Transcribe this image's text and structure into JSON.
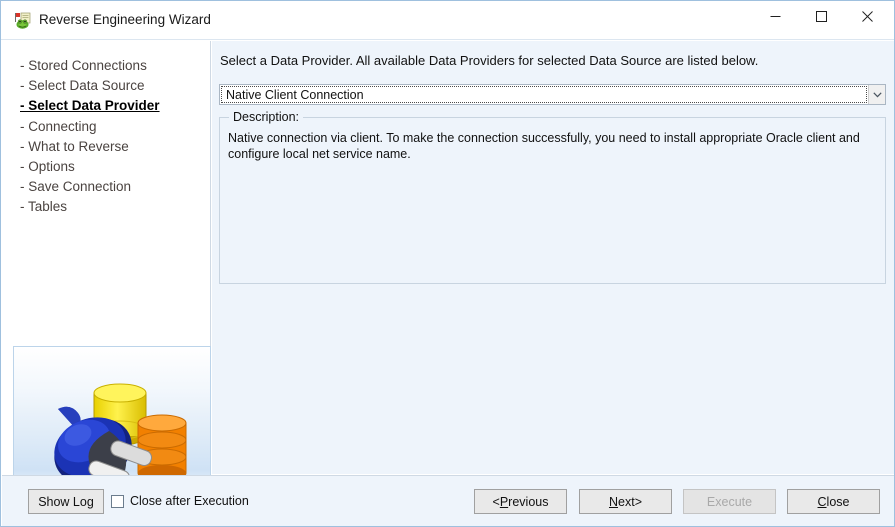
{
  "window": {
    "title": "Reverse Engineering Wizard",
    "icon": "frog-flag-icon",
    "controls": {
      "minimize": "minimize-icon",
      "maximize": "maximize-icon",
      "close": "close-icon"
    }
  },
  "sidebar": {
    "steps": [
      {
        "label": "- Stored Connections",
        "active": false
      },
      {
        "label": "- Select Data Source",
        "active": false
      },
      {
        "label": "- Select Data Provider",
        "active": true
      },
      {
        "label": "- Connecting",
        "active": false
      },
      {
        "label": "- What to Reverse",
        "active": false
      },
      {
        "label": "- Options",
        "active": false
      },
      {
        "label": "- Save Connection",
        "active": false
      },
      {
        "label": "- Tables",
        "active": false
      }
    ],
    "artwork": "database-plug-illustration"
  },
  "main": {
    "instruction": "Select a Data Provider. All available Data Providers for selected Data Source are listed below.",
    "provider_combo": {
      "value": "Native Client Connection",
      "placeholder": "Native Client Connection",
      "dropdown_icon": "chevron-down-icon"
    },
    "description": {
      "legend": "Description:",
      "text": "Native connection via client. To make the connection successfully, you need to install appropriate Oracle client and configure local net service name."
    }
  },
  "footer": {
    "show_log": "Show Log",
    "close_after_execution": {
      "label": "Close after Execution",
      "checked": false
    },
    "previous": {
      "prefix": "< ",
      "accel": "P",
      "rest": "revious"
    },
    "next": {
      "accel": "N",
      "rest": "ext",
      "suffix": " >"
    },
    "execute": {
      "label": "Execute",
      "enabled": false
    },
    "close": {
      "accel": "C",
      "rest": "lose"
    }
  },
  "colors": {
    "panel_background": "#eef4fb",
    "window_border": "#9fc0de",
    "active_step": "#000000",
    "inactive_step": "#4a4340",
    "button_face": "#e9e9e9",
    "disabled_text": "#a9a9a9"
  }
}
